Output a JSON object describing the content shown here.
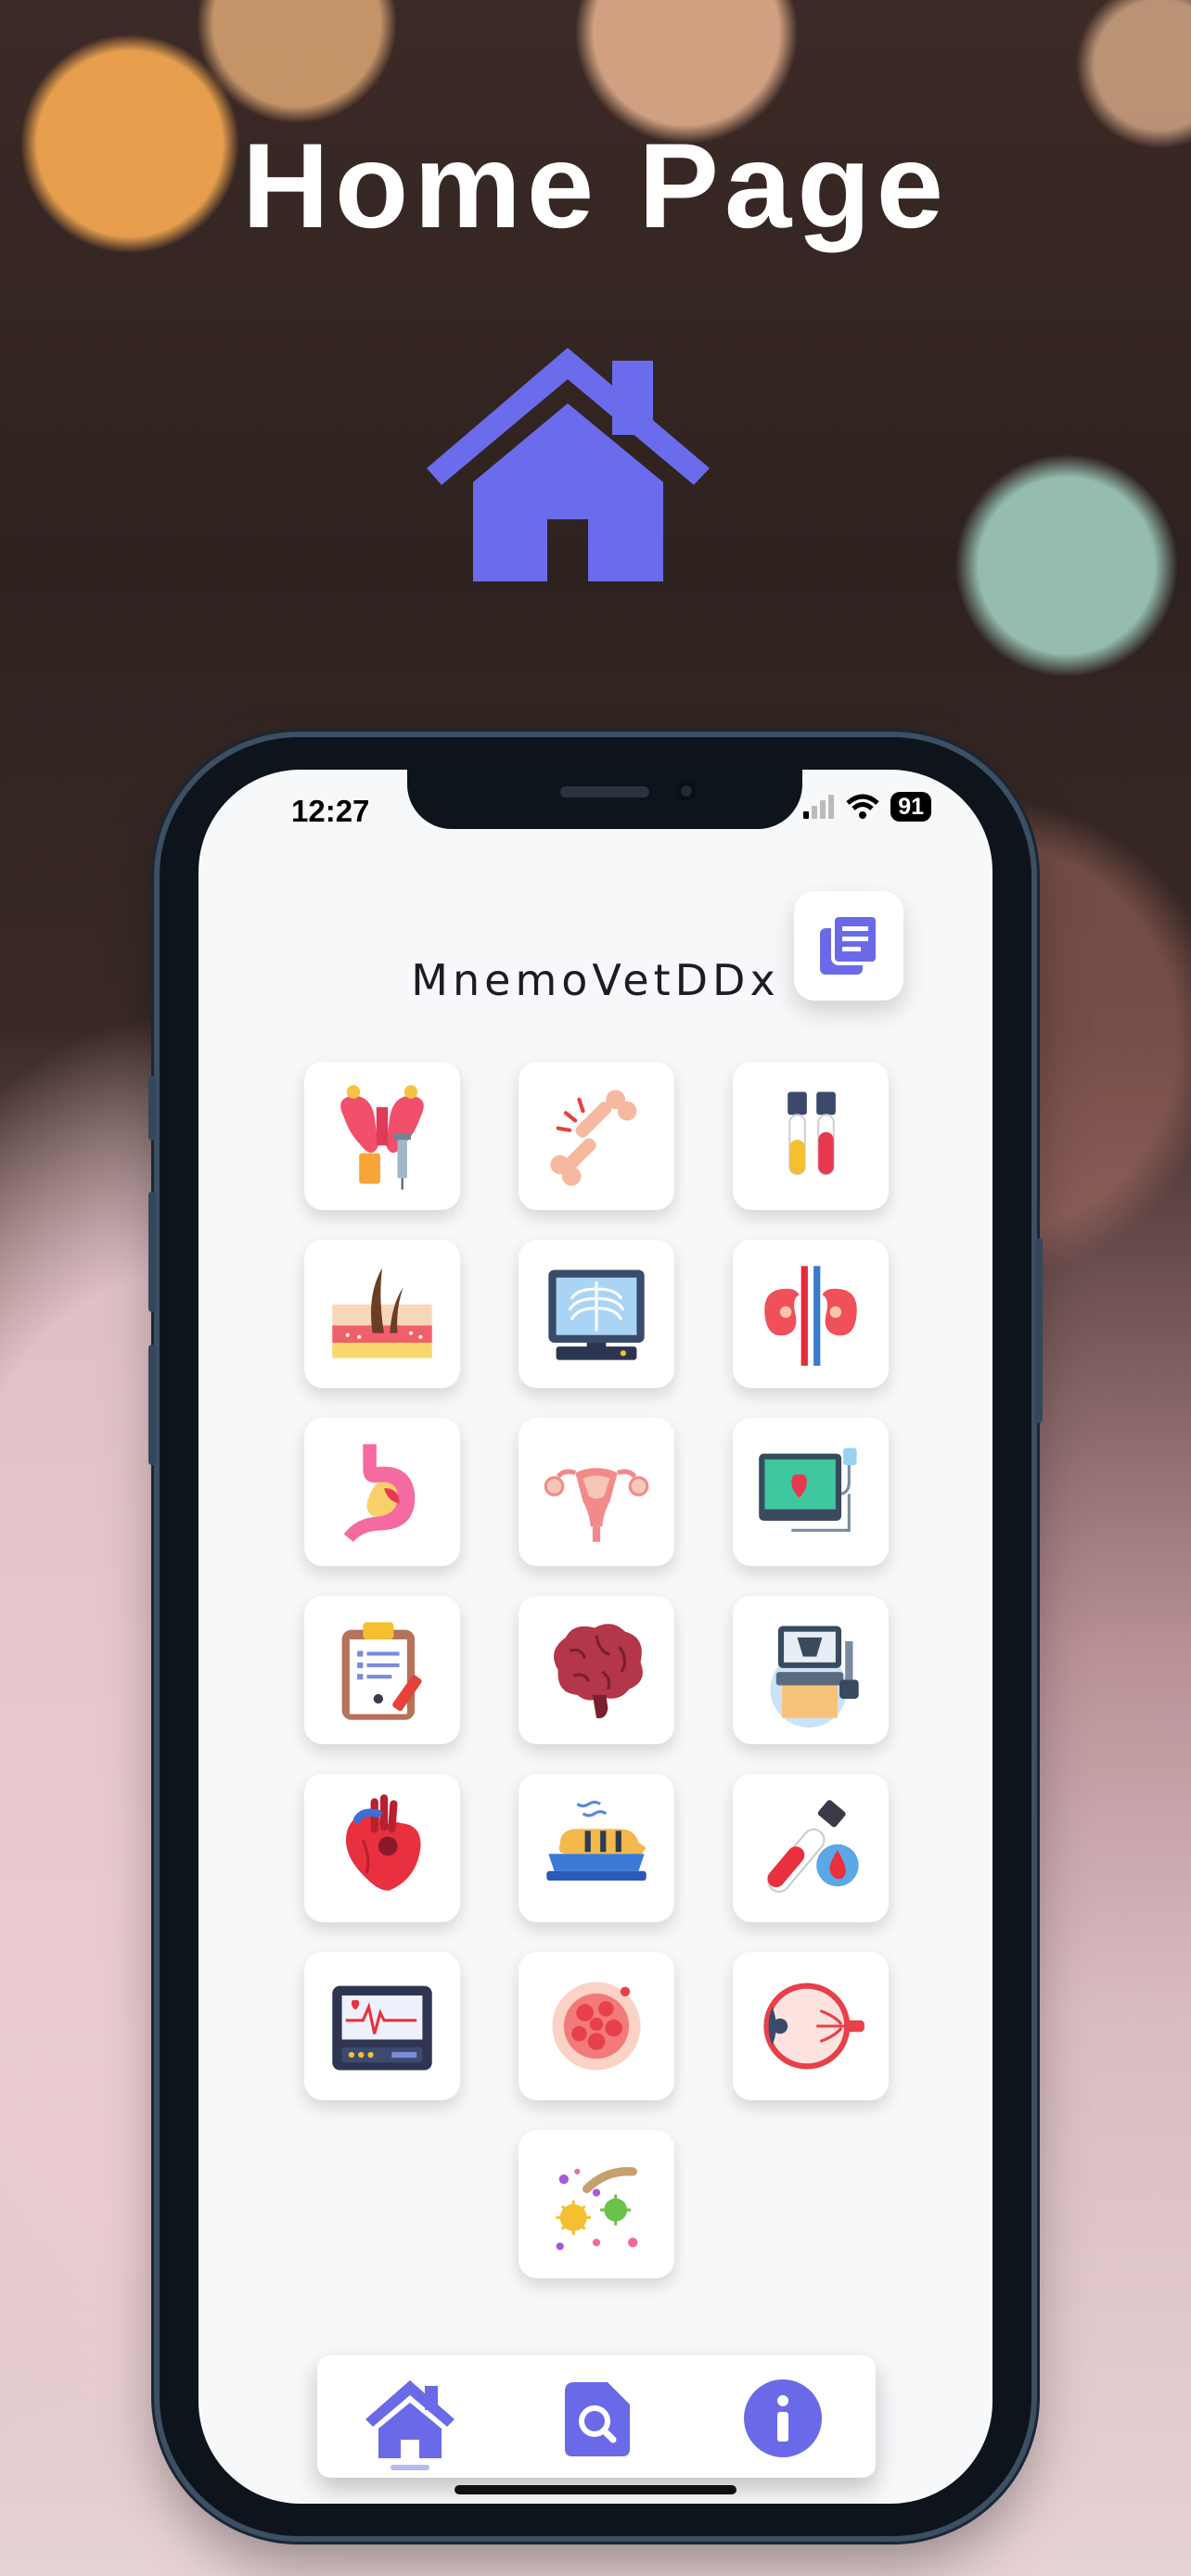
{
  "page": {
    "headline": "Home Page"
  },
  "status_bar": {
    "time": "12:27",
    "battery": "91"
  },
  "app": {
    "title": "MnemoVetDDx",
    "accent": "#6a6ae8"
  },
  "tiles": [
    "endocrine-icon",
    "bone-fracture-icon",
    "blood-tubes-icon",
    "skin-icon",
    "xray-monitor-icon",
    "kidneys-icon",
    "stomach-icon",
    "uterus-icon",
    "ecg-monitor-icon",
    "clipboard-icon",
    "brain-icon",
    "ultrasound-machine-icon",
    "heart-icon",
    "animal-bath-icon",
    "blood-test-icon",
    "vital-monitor-icon",
    "cell-icon",
    "eye-icon",
    "microbes-icon"
  ],
  "tabbar": {
    "items": [
      "home-tab-icon",
      "search-tab-icon",
      "info-tab-icon"
    ],
    "active": "home-tab-icon"
  }
}
